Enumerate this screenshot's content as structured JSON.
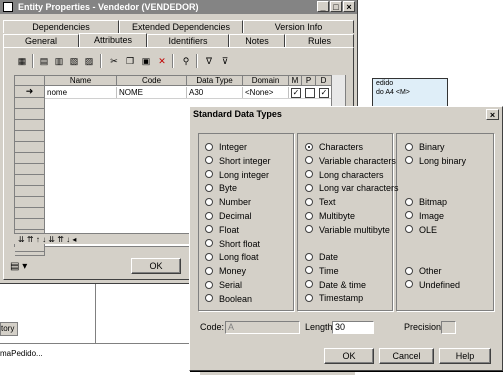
{
  "background": {
    "diagram_box": {
      "line1": "edido",
      "line2": "do  A4  <M>"
    },
    "tab_stub": "tory",
    "status_text": "maPedido..."
  },
  "entity_window": {
    "title": "Entity Properties - Vendedor (VENDEDOR)",
    "title_buttons": [
      "_",
      "□",
      "×"
    ],
    "tabs_row1": [
      "Dependencies",
      "Extended Dependencies",
      "Version Info"
    ],
    "tabs_row2": [
      "General",
      "Attributes",
      "Identifiers",
      "Notes",
      "Rules"
    ],
    "active_tab": "Attributes",
    "toolbar_icons": [
      "properties-icon",
      "insert-row-icon",
      "add-row-icon",
      "add-attributes-icon",
      "reuse-icon",
      "cut-icon",
      "copy-icon",
      "paste-icon",
      "delete-icon",
      "find-icon",
      "filter-icon",
      "clear-filter-icon"
    ],
    "grid": {
      "columns": [
        "Name",
        "Code",
        "Data Type",
        "Domain",
        "M",
        "P",
        "D"
      ],
      "rows": [
        {
          "marker": "➜",
          "name": "nome",
          "code": "NOME",
          "data_type": "A30",
          "domain": "<None>",
          "m": true,
          "p": false,
          "d": true
        }
      ],
      "nav_arrows": "⇊ ⇈ ↑ ↓ ⇊ ⇈ ↓ ◂"
    },
    "ok_label": "OK",
    "menu_icon": "▤ ▾"
  },
  "dialog": {
    "title": "Standard Data Types",
    "close": "×",
    "column1": [
      "Integer",
      "Short integer",
      "Long integer",
      "Byte",
      "Number",
      "Decimal",
      "Float",
      "Short float",
      "Long float",
      "Money",
      "Serial",
      "Boolean"
    ],
    "column2a": [
      "Characters",
      "Variable characters",
      "Long characters",
      "Long var characters",
      "Text",
      "Multibyte",
      "Variable multibyte"
    ],
    "column2b": [
      "Date",
      "Time",
      "Date & time",
      "Timestamp"
    ],
    "column3a": [
      "Binary",
      "Long binary"
    ],
    "column3b": [
      "Bitmap",
      "Image",
      "OLE"
    ],
    "column3c": [
      "Other",
      "Undefined"
    ],
    "selected": "Characters",
    "code_label": "Code:",
    "code_value": "A",
    "length_label": "Length:",
    "length_value": "30",
    "precision_label": "Precision:",
    "precision_value": "",
    "ok": "OK",
    "cancel": "Cancel",
    "help": "Help"
  }
}
